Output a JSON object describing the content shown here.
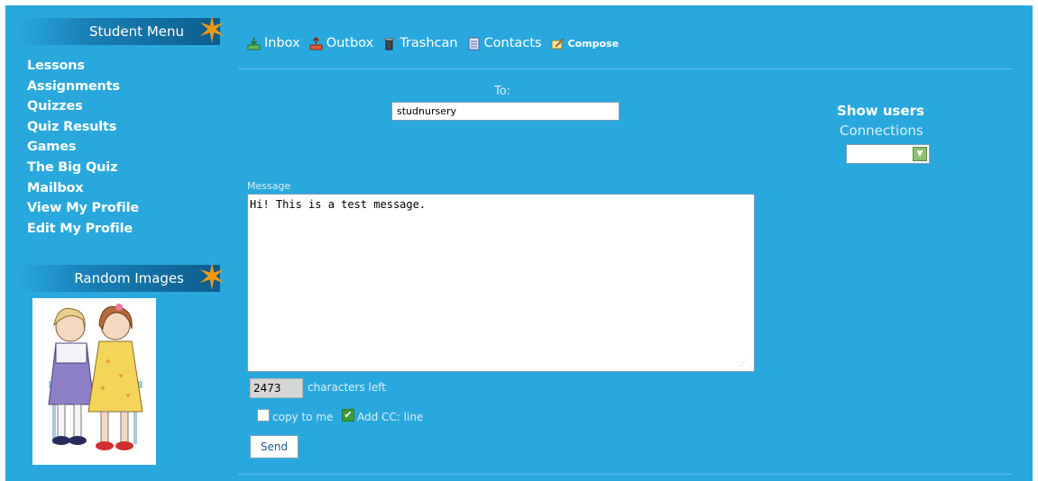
{
  "sidebar": {
    "menu_title": "Student Menu",
    "menu_items": [
      "Lessons",
      "Assignments",
      "Quizzes",
      "Quiz Results",
      "Games",
      "The Big Quiz",
      "Mailbox",
      "View My Profile",
      "Edit My Profile"
    ],
    "images_title": "Random Images"
  },
  "nav": {
    "inbox": "Inbox",
    "outbox": "Outbox",
    "trashcan": "Trashcan",
    "contacts": "Contacts",
    "compose": "Compose"
  },
  "form": {
    "to_label": "To:",
    "to_value": "studnursery",
    "message_label": "Message",
    "message_value": "Hi! This is a test message.",
    "chars_left_value": "2473",
    "chars_left_label": "characters left",
    "copy_to_me_label": "copy to me",
    "copy_to_me_checked": false,
    "add_cc_label": "Add CC: line",
    "add_cc_checked": true,
    "send_label": "Send"
  },
  "users_panel": {
    "title": "Show users",
    "connections_label": "Connections",
    "connections_selected": ""
  },
  "colors": {
    "background": "#29a8dd",
    "accent_star": "#f09a12",
    "header_dark": "#0c5d8c"
  }
}
